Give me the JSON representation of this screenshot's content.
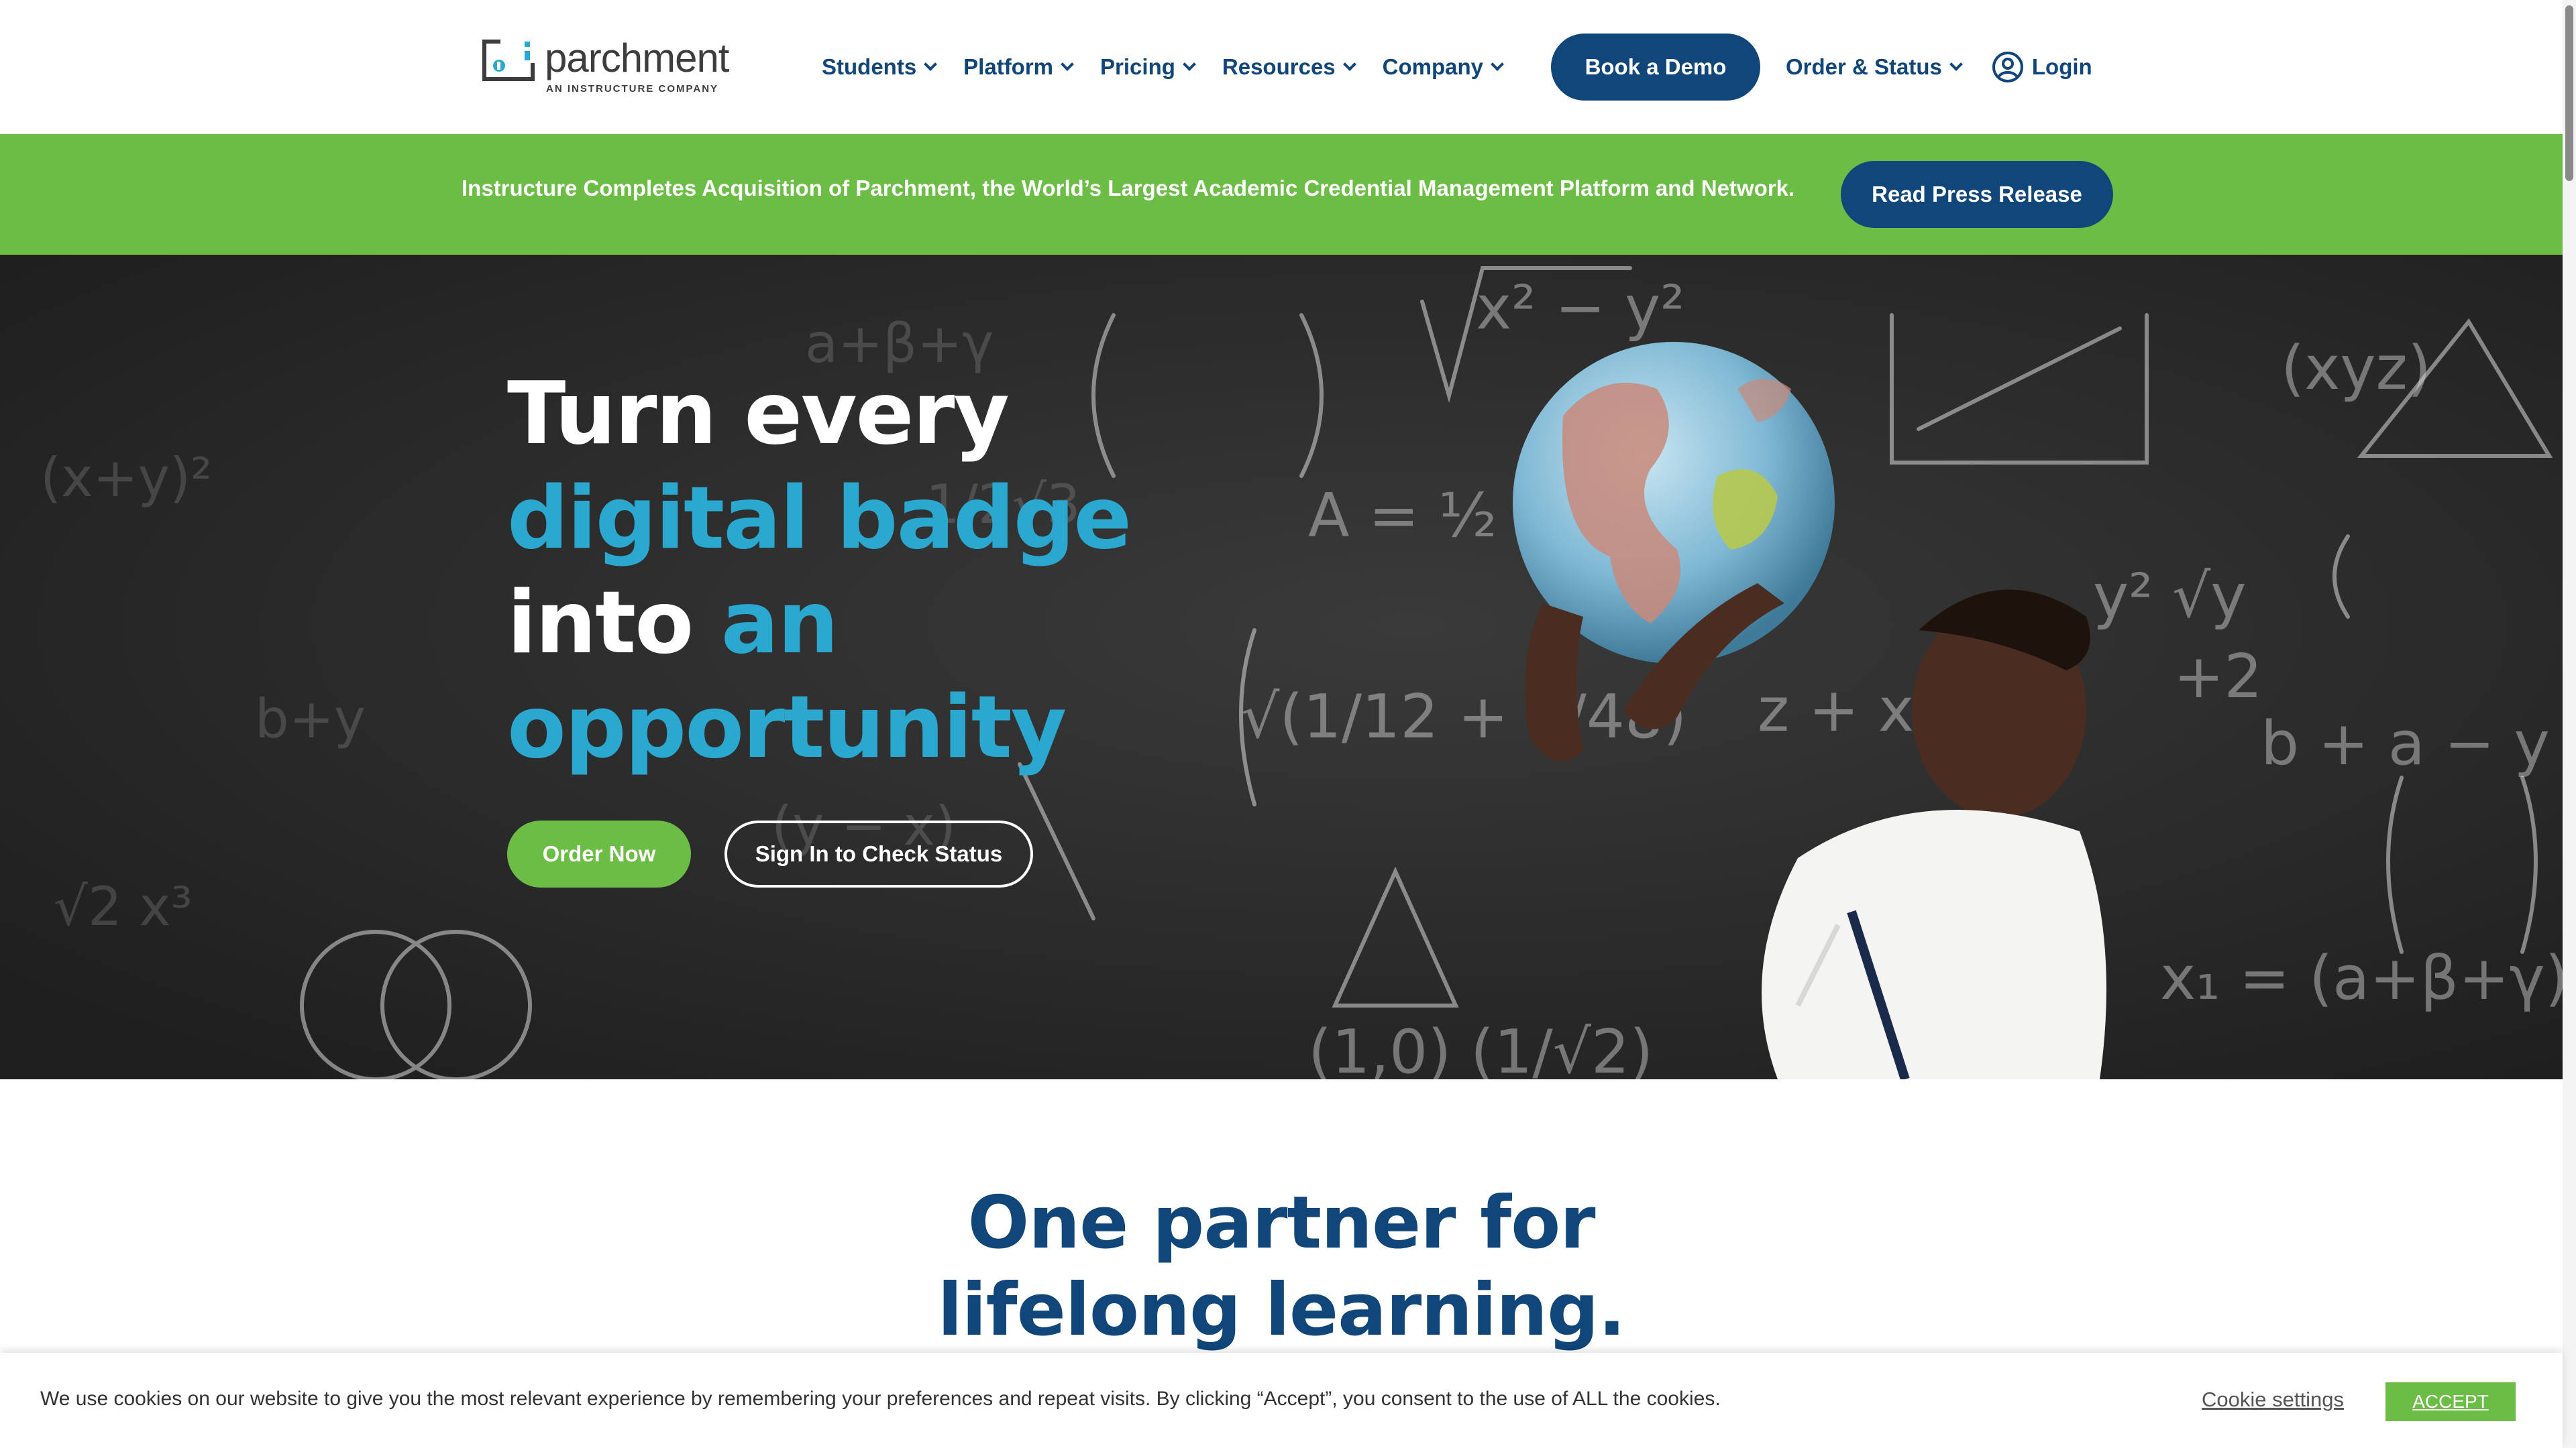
{
  "brand": {
    "name": "parchment",
    "tagline": "AN INSTRUCTURE COMPANY",
    "logo_icon": "parchment-logo-icon"
  },
  "nav": {
    "items": [
      {
        "label": "Students"
      },
      {
        "label": "Platform"
      },
      {
        "label": "Pricing"
      },
      {
        "label": "Resources"
      },
      {
        "label": "Company"
      }
    ],
    "demo_button": "Book a Demo",
    "order_status": "Order & Status",
    "login": "Login",
    "login_icon": "user-circle-icon"
  },
  "banner": {
    "text": "Instructure Completes Acquisition of Parchment, the World’s Largest Academic Credential Management Platform and Network.",
    "button": "Read Press Release"
  },
  "hero": {
    "line1": "Turn every",
    "line2": "digital badge",
    "line3a": "into",
    "line3b": "an",
    "line4": "opportunity",
    "order_button": "Order Now",
    "signin_button": "Sign In to Check Status",
    "image": "chalkboard-student-globe-photo"
  },
  "section": {
    "title_line1": "One partner for",
    "title_line2": "lifelong learning."
  },
  "cookie": {
    "text": "We use cookies on our website to give you the most relevant experience by remembering your preferences and repeat visits. By clicking “Accept”, you consent to the use of ALL the cookies.",
    "settings": "Cookie settings",
    "accept": "ACCEPT"
  },
  "colors": {
    "navy": "#10467a",
    "green": "#6cbd45",
    "teal": "#2aa8d0",
    "chalkboard": "#2b2b2b"
  }
}
